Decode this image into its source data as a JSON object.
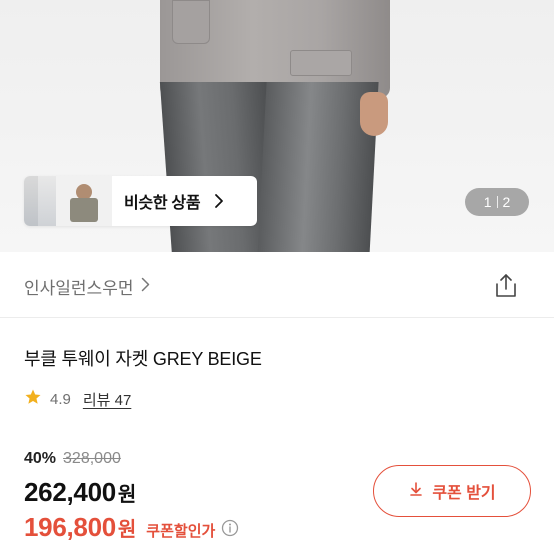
{
  "hero": {
    "similar_label": "비슷한 상품",
    "pager_current": "1",
    "pager_total": "2"
  },
  "brand": {
    "name": "인사일런스우먼"
  },
  "product": {
    "title": "부클 투웨이 자켓 GREY BEIGE",
    "rating": "4.9",
    "review_label": "리뷰 47",
    "discount": "40%",
    "original_price": "328,000",
    "price": "262,400",
    "price_unit": "원",
    "coupon_price": "196,800",
    "coupon_price_unit": "원",
    "coupon_price_label": "쿠폰할인가"
  },
  "coupon_button": {
    "label": "쿠폰 받기"
  },
  "icons": {
    "chevron": "chevron-right-icon",
    "share": "share-icon",
    "star": "star-icon",
    "info": "info-icon",
    "download": "download-icon"
  },
  "colors": {
    "accent": "#e4503b",
    "star": "#f2b01e"
  }
}
